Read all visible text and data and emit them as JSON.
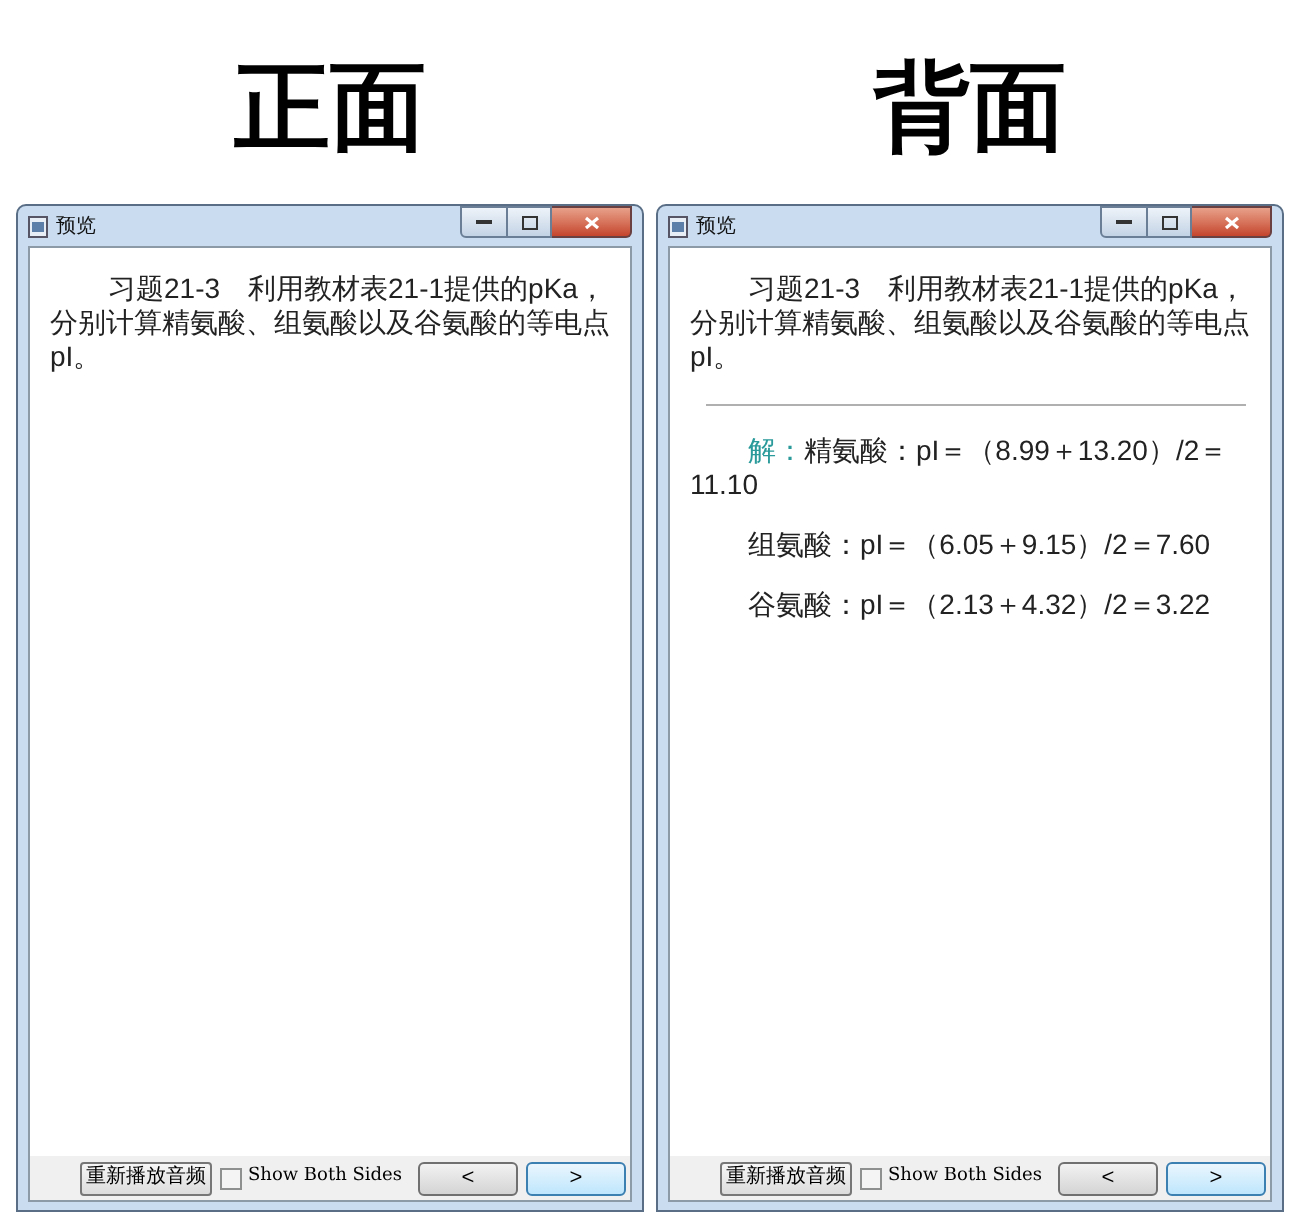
{
  "panels": [
    {
      "heading": "正面",
      "window": {
        "title": "预览",
        "question": "习题21-3　利用教材表21-1提供的pKa，分别计算精氨酸、组氨酸以及谷氨酸的等电点pI。",
        "replay_button": "重新播放音频",
        "show_both_sides": {
          "label": "Show Both Sides",
          "checked": false
        },
        "prev_button": "<",
        "next_button": ">"
      }
    },
    {
      "heading": "背面",
      "window": {
        "title": "预览",
        "question": "习题21-3　利用教材表21-1提供的pKa，分别计算精氨酸、组氨酸以及谷氨酸的等电点pI。",
        "answer": [
          {
            "label": "解：",
            "text": "精氨酸：pI＝（8.99＋13.20）/2＝11.10"
          },
          {
            "text": "组氨酸：pI＝（6.05＋9.15）/2＝7.60"
          },
          {
            "text": "谷氨酸：pI＝（2.13＋4.32）/2＝3.22"
          }
        ],
        "replay_button": "重新播放音频",
        "show_both_sides": {
          "label": "Show Both Sides",
          "checked": false
        },
        "prev_button": "<",
        "next_button": ">"
      }
    }
  ]
}
